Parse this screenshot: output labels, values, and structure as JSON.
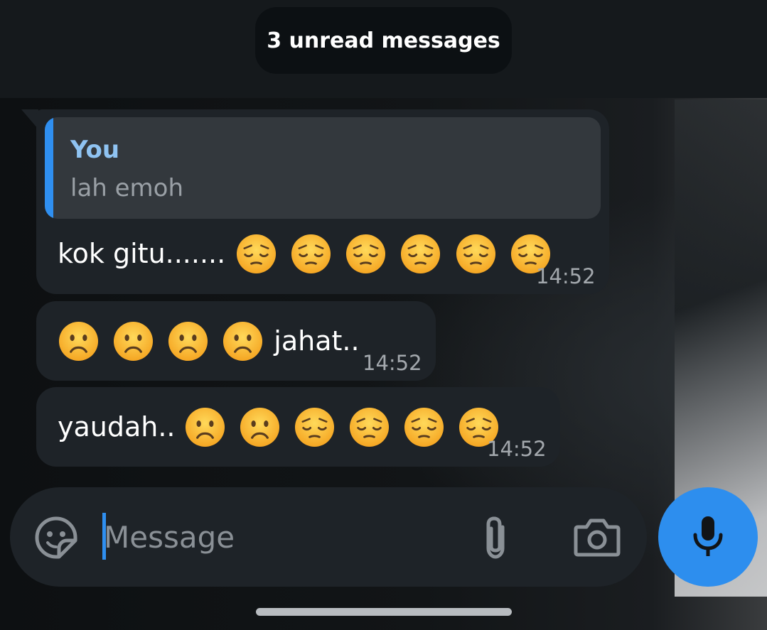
{
  "banner": {
    "unread_label": "3 unread messages"
  },
  "messages": [
    {
      "reply": {
        "sender": "You",
        "text": "lah emoh"
      },
      "text": "kok gitu.......",
      "emojis": [
        "pensive-emoji",
        "pensive-emoji",
        "pensive-emoji",
        "pensive-emoji",
        "pensive-emoji",
        "pensive-emoji"
      ],
      "time": "14:52"
    },
    {
      "emojis_before": [
        "frowning-emoji",
        "frowning-emoji",
        "frowning-emoji",
        "frowning-emoji"
      ],
      "text": "jahat..",
      "time": "14:52"
    },
    {
      "text": "yaudah..",
      "emojis": [
        "frowning-emoji",
        "frowning-emoji",
        "pensive-emoji",
        "pensive-emoji",
        "pensive-emoji",
        "pensive-emoji"
      ],
      "time": "14:52"
    }
  ],
  "composer": {
    "placeholder": "Message",
    "icons": [
      "sticker-icon",
      "paperclip-icon",
      "camera-icon",
      "microphone-icon"
    ]
  },
  "colors": {
    "accent": "#2d8eee",
    "bubble": "#1e2328",
    "quote_bg": "#33383d",
    "quote_sender": "#8fc3f2",
    "timestamp": "#a3a8ad"
  }
}
